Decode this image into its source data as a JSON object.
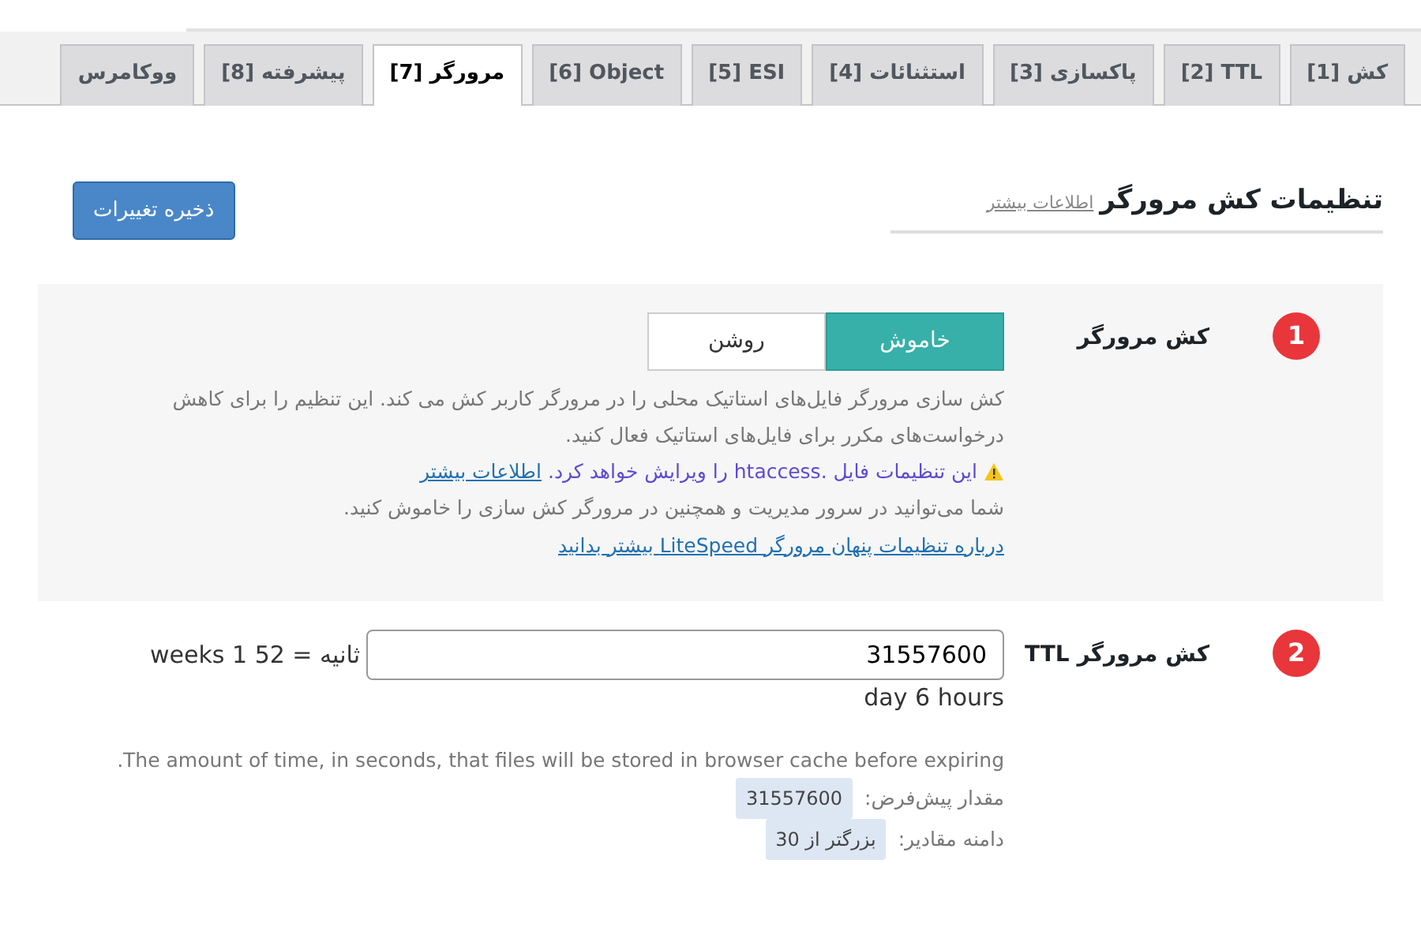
{
  "tabs": [
    {
      "label": "[1] کش",
      "selected": false
    },
    {
      "label": "[2] TTL",
      "selected": false
    },
    {
      "label": "[3] پاکسازی",
      "selected": false
    },
    {
      "label": "[4] استثنائات",
      "selected": false
    },
    {
      "label": "[5] ESI",
      "selected": false
    },
    {
      "label": "[6] Object",
      "selected": false
    },
    {
      "label": "[7] مرورگر",
      "selected": true
    },
    {
      "label": "[8] پیشرفته",
      "selected": false
    },
    {
      "label": "ووکامرس",
      "selected": false
    }
  ],
  "heading": {
    "title": "تنظیمات کش مرورگر",
    "link": "اطلاعات بیشتر"
  },
  "save_button": "ذخیره تغییرات",
  "settings": [
    {
      "kind": "toggle",
      "number": "1",
      "label": "کش مرورگر",
      "options": [
        {
          "label": "خاموش",
          "selected": true
        },
        {
          "label": "روشن",
          "selected": false
        }
      ],
      "description": "کش سازی مرورگر فایل‌های استاتیک محلی را در مرورگر کاربر کش می کند. این تنظیم را برای کاهش درخواست‌های مکرر برای فایل‌های استاتیک فعال کنید.",
      "warning": "این تنظیمات فایل .htaccess را ویرایش خواهد کرد.",
      "warning_link": "اطلاعات بیشتر",
      "note": "شما می‌توانید در سرور مدیریت و همچنین در مرورگر کش سازی را خاموش کنید.",
      "note_link": "درباره تنظیمات پنهان مرورگر LiteSpeed بیشتر بدانید"
    },
    {
      "kind": "number",
      "number": "2",
      "label": "کش مرورگر TTL",
      "value": "31557600",
      "readout": "ثانیه = 52 weeks 1",
      "readout_2": "day 6 hours",
      "description": "The amount of time, in seconds, that files will be stored in browser cache before expiring.",
      "default_label": "مقدار پیش‌فرض:",
      "default_value": "31557600",
      "range_label": "دامنه مقادیر:",
      "range_value": "بزرگتر از 30"
    }
  ]
}
